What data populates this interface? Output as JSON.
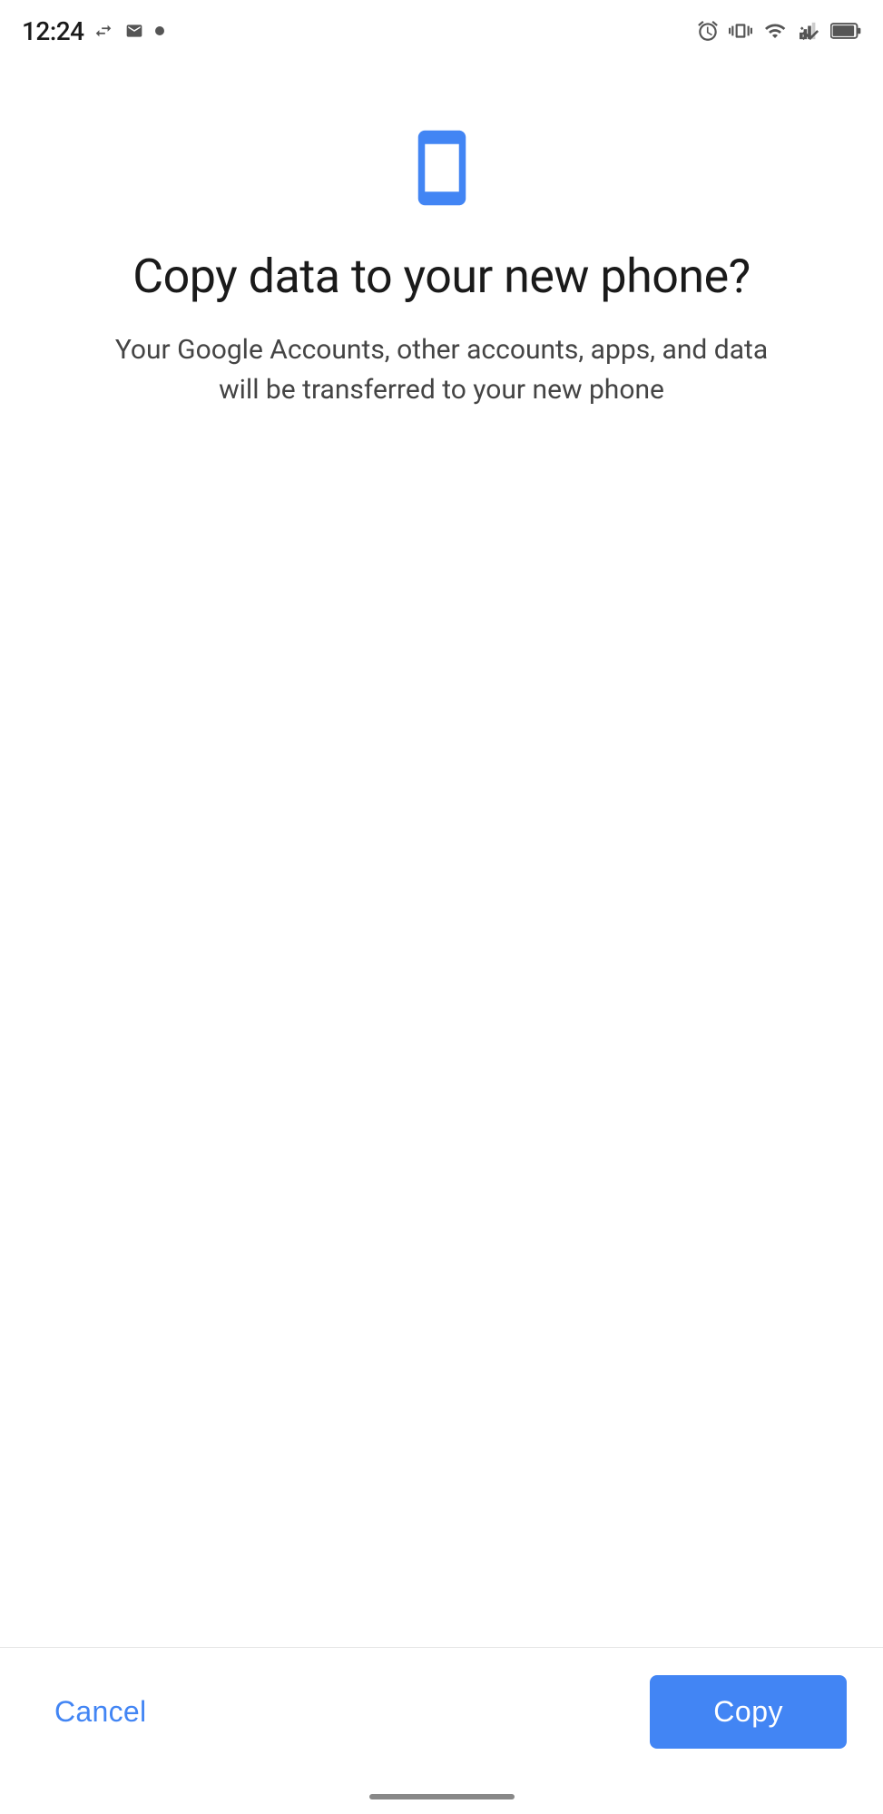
{
  "statusBar": {
    "time": "12:24",
    "icons": {
      "arrowLeft": "←",
      "mail": "✉",
      "dot": "•",
      "alarm": "alarm-icon",
      "vibrate": "vibrate-icon",
      "wifi": "wifi-icon",
      "signal": "signal-icon",
      "battery": "battery-icon"
    }
  },
  "page": {
    "phoneIcon": "phone-icon",
    "title": "Copy data to your new phone?",
    "subtitle": "Your Google Accounts, other accounts, apps, and data will be transferred to your new phone"
  },
  "actions": {
    "cancel": "Cancel",
    "copy": "Copy"
  },
  "colors": {
    "accent": "#4285f4",
    "textPrimary": "#1a1a1a",
    "textSecondary": "#444444",
    "background": "#ffffff"
  }
}
